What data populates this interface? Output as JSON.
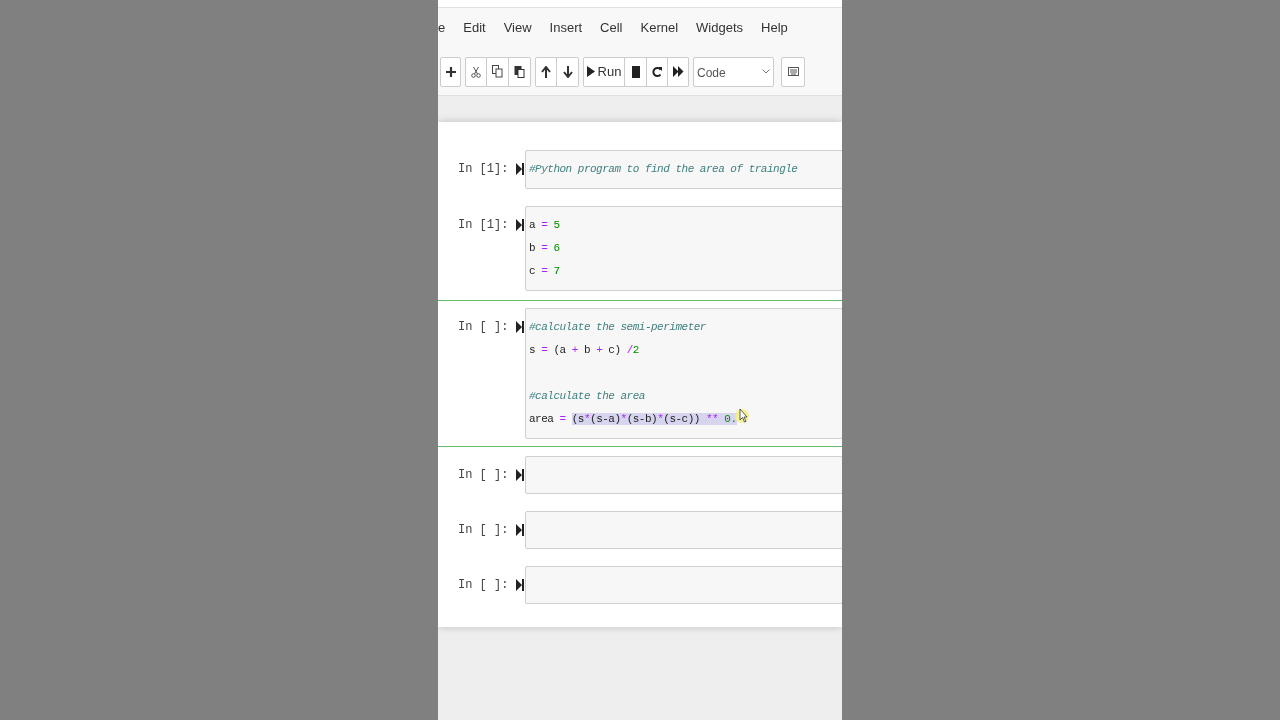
{
  "menu": [
    "e",
    "Edit",
    "View",
    "Insert",
    "Cell",
    "Kernel",
    "Widgets",
    "Help"
  ],
  "toolbar": {
    "run_label": "Run",
    "cell_type": "Code"
  },
  "cells": [
    {
      "prompt": "In [1]:",
      "selected": false,
      "lines": [
        {
          "kind": "code",
          "text": "#Python program to find the area of traingle"
        }
      ]
    },
    {
      "prompt": "In [1]:",
      "selected": false,
      "lines": [
        {
          "kind": "code",
          "text": "a = 5"
        },
        {
          "kind": "code",
          "text": "b = 6"
        },
        {
          "kind": "code",
          "text": "c = 7"
        }
      ]
    },
    {
      "prompt": "In [ ]:",
      "selected": true,
      "lines": [
        {
          "kind": "code",
          "text": "#calculate the semi-perimeter"
        },
        {
          "kind": "code",
          "text": "s = (a + b + c) /2"
        },
        {
          "kind": "blank"
        },
        {
          "kind": "code",
          "text": "#calculate the area"
        },
        {
          "kind": "code",
          "text": "area = ",
          "selected_text": "(s*(s-a)*(s-b)*(s-c)) ** 0."
        }
      ]
    },
    {
      "prompt": "In [ ]:",
      "selected": false
    },
    {
      "prompt": "In [ ]:",
      "selected": false
    },
    {
      "prompt": "In [ ]:",
      "selected": false
    }
  ]
}
